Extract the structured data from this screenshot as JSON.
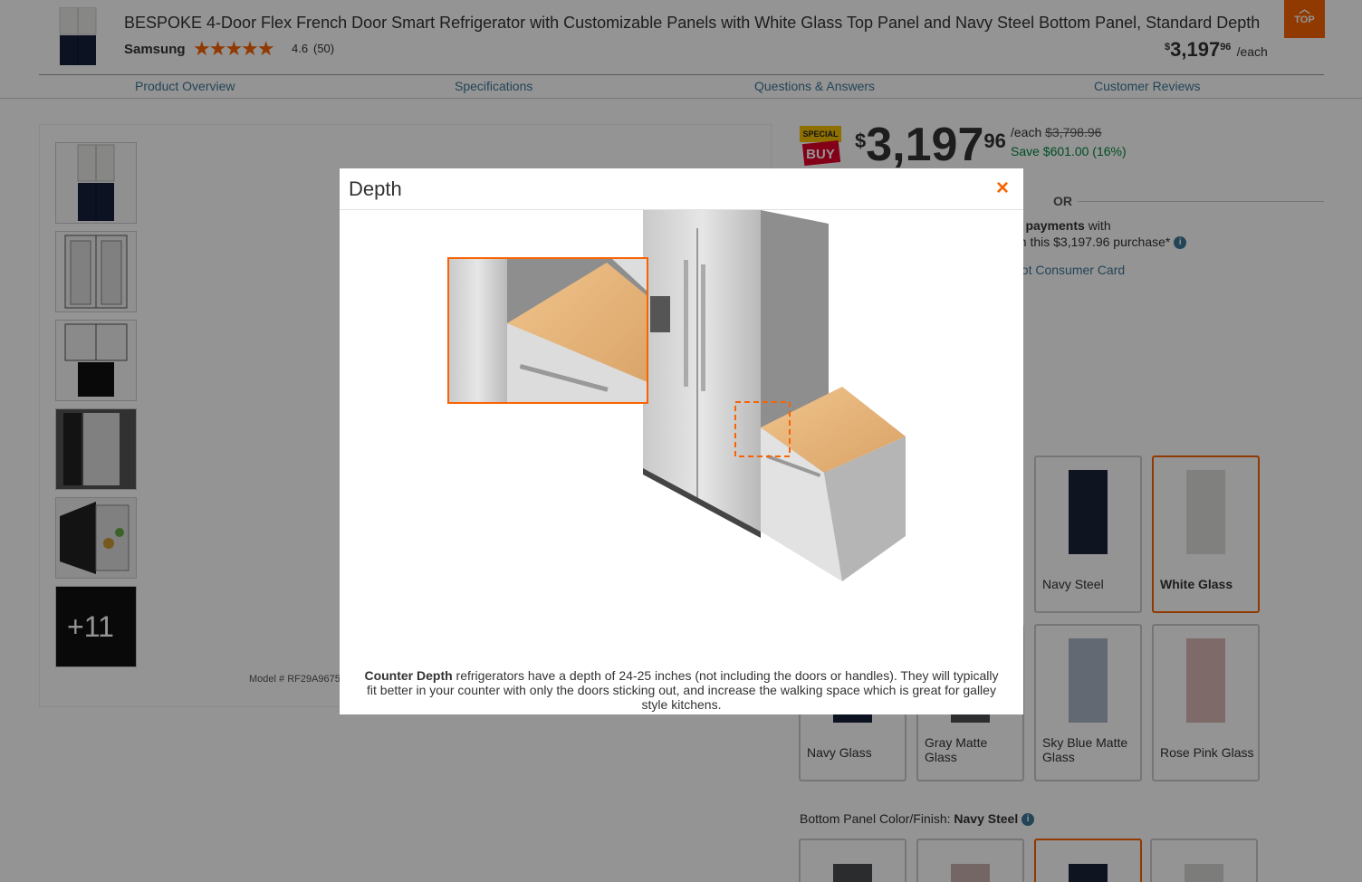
{
  "header": {
    "product_title": "BESPOKE 4-Door Flex French Door Smart Refrigerator with Customizable Panels with White Glass Top Panel and Navy Steel Bottom Panel,  Standard Depth",
    "brand": "Samsung",
    "rating": "4.6",
    "review_count": "(50)",
    "rating_value": 4.6,
    "price_dollar": "$",
    "price_main": "3,197",
    "price_cents": "96",
    "price_unit": "/each",
    "top_button": "TOP"
  },
  "nav": {
    "overview": "Product Overview",
    "specs": "Specifications",
    "qa": "Questions & Answers",
    "reviews": "Customer Reviews"
  },
  "gallery": {
    "more_count": "+11",
    "model_prefix": "Model # RF29A9675"
  },
  "pricing": {
    "badge_top": "SPECIAL",
    "badge_bottom": "BUY",
    "currency": "$",
    "price_main": "3,197",
    "price_cents": "96",
    "unit": "/each",
    "was_price": "$3,798.96",
    "savings": "Save $601.00 (16%)",
    "or_label": "OR",
    "payments_bold": "d payments",
    "payments_tail": " with",
    "purchase_line": "on this $3,197.96 purchase*",
    "card_link": "pot Consumer Card"
  },
  "top_panel": {
    "swatches": [
      {
        "label": "Navy Steel",
        "color": "#1b2538"
      },
      {
        "label": "White Glass",
        "color": "#dcdcda",
        "selected": true
      },
      {
        "label": "Navy Glass",
        "color": "#17203a"
      },
      {
        "label": "Gray Matte Glass",
        "color": "#4e5052"
      },
      {
        "label": "Sky Blue Matte Glass",
        "color": "#a9b6c4"
      },
      {
        "label": "Rose Pink Glass",
        "color": "#d9b8b6"
      }
    ]
  },
  "bottom_panel": {
    "label": "Bottom Panel Color/Finish: ",
    "value": "Navy Steel"
  },
  "modal": {
    "title": "Depth",
    "close_icon": "×",
    "desc_bold": "Counter Depth",
    "desc_rest": " refrigerators have a depth of 24-25 inches (not including the doors or handles). They will typically fit better in your counter with only the doors sticking out, and increase the walking space which is great for galley style kitchens.",
    "accent_color": "#f96302"
  }
}
